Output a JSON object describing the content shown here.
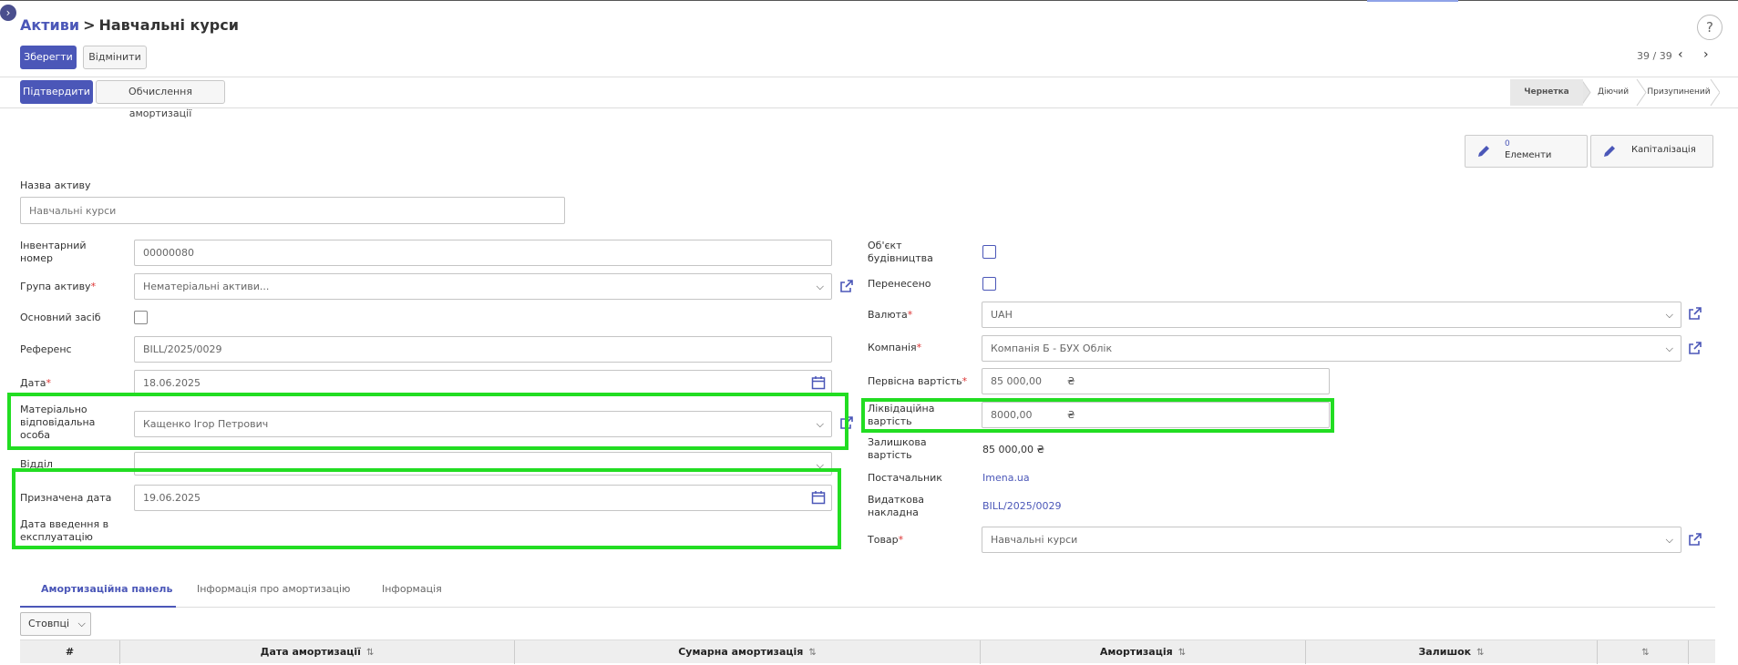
{
  "breadcrumb": {
    "parent": "Активи",
    "separator": ">",
    "current": "Навчальні курси"
  },
  "toolbar": {
    "save_label": "Зберегти",
    "discard_label": "Відмінити"
  },
  "pager": {
    "value": "39 / 39"
  },
  "actions": {
    "confirm_label": "Підтвердити",
    "compute_label": "Обчислення амортизації"
  },
  "statusbar": {
    "items": [
      "Чернетка",
      "Діючий",
      "Призупинений"
    ],
    "active": "Чернетка"
  },
  "stat_buttons": {
    "elements": {
      "count": "0",
      "label": "Елементи"
    },
    "capitalization": {
      "label": "Капіталізація"
    }
  },
  "form": {
    "asset_name": {
      "label": "Назва активу",
      "placeholder": "Навчальні курси"
    },
    "inventory_number": {
      "label": "Інвентарний номер",
      "value": "00000080"
    },
    "asset_group": {
      "label": "Група активу",
      "value": "Нематеріальні активи..."
    },
    "fixed_asset": {
      "label": "Основний засіб"
    },
    "reference": {
      "label": "Референс",
      "value": "BILL/2025/0029"
    },
    "date": {
      "label": "Дата",
      "value": "18.06.2025"
    },
    "responsible_person": {
      "label": "Матеріально відповідальна особа",
      "value": "Кащенко Ігор Петрович"
    },
    "department": {
      "label": "Відділ",
      "value": ""
    },
    "assigned_date": {
      "label": "Призначена дата",
      "value": "19.06.2025"
    },
    "commissioning_date": {
      "label": "Дата введення в експлуатацію",
      "value": ""
    },
    "construction_object": {
      "label": "Об'єкт будівництва"
    },
    "transferred": {
      "label": "Перенесено"
    },
    "currency": {
      "label": "Валюта",
      "value": "UAH"
    },
    "company": {
      "label": "Компанія",
      "value": "Компанія Б - БУХ Облік"
    },
    "original_value": {
      "label": "Первісна вартість",
      "value": "85 000,00",
      "currency": "₴"
    },
    "salvage_value": {
      "label": "Ліквідаційна вартість",
      "value": "8000,00",
      "currency": "₴"
    },
    "residual_value": {
      "label": "Залишкова вартість",
      "value": "85 000,00 ₴"
    },
    "vendor": {
      "label": "Постачальник",
      "value": "Imena.ua"
    },
    "expense_invoice": {
      "label": "Видаткова накладна",
      "value": "BILL/2025/0029"
    },
    "product": {
      "label": "Товар",
      "value": "Навчальні курси"
    }
  },
  "tabs": [
    {
      "label": "Амортизаційна панель",
      "active": true
    },
    {
      "label": "Інформація про амортизацію",
      "active": false
    },
    {
      "label": "Інформація",
      "active": false
    }
  ],
  "table": {
    "columns_button": "Стовпці",
    "headers": [
      "#",
      "Дата амортизації",
      "Сумарна амортизація",
      "Амортизація",
      "Залишок",
      ""
    ]
  },
  "colors": {
    "accent": "#4b57b8",
    "highlight": "#22dd22",
    "required": "#d33333"
  },
  "icons": [
    "sidebar-toggle-icon",
    "help-icon",
    "chevron-left-icon",
    "chevron-right-icon",
    "pencil-icon",
    "external-link-icon",
    "calendar-icon",
    "chevron-down-icon",
    "sort-icon"
  ]
}
